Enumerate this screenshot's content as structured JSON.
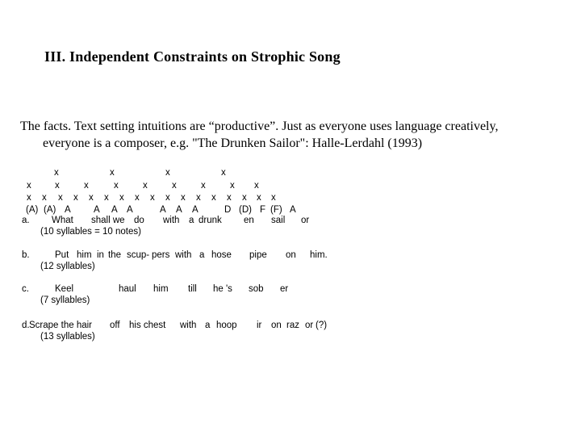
{
  "title": "III. Independent Constraints on Strophic Song",
  "paragraph": {
    "line1": "The facts. Text setting intuitions are “productive”. Just as everyone uses language creatively,",
    "line2": "everyone is a composer, e.g. \"The Drunken Sailor\": Halle-Lerdahl (1993)"
  },
  "grid": {
    "row1": [
      "x",
      "x",
      "x",
      "x"
    ],
    "row2": [
      "x",
      "x",
      "x",
      "x",
      "x",
      "x",
      "x",
      "x",
      "x"
    ],
    "row3": [
      "x",
      "x",
      "x",
      "x",
      "x",
      "x",
      "x",
      "x",
      "x",
      "x",
      "x",
      "x",
      "x",
      "x",
      "x",
      "x",
      "x"
    ],
    "pitches": [
      "(A)",
      "(A)",
      "A",
      "A",
      "A",
      "A",
      "A",
      "A",
      "A",
      "D",
      "(D)",
      "F",
      "(F)",
      "A"
    ]
  },
  "examples": {
    "a": {
      "label": "a.",
      "words": [
        "What",
        "shall we",
        "do",
        "with",
        "a",
        "drunk",
        "en",
        "sail",
        "or"
      ],
      "count": "(10 syllables = 10 notes)"
    },
    "b": {
      "label": "b.",
      "words": [
        "Put",
        "him",
        "in",
        "the",
        "scup-",
        "pers",
        "with",
        "a",
        "hose",
        "pipe",
        "on",
        "him."
      ],
      "count": "(12 syllables)"
    },
    "c": {
      "label": "c.",
      "words": [
        "Keel",
        "haul",
        "him",
        "till",
        "he 's",
        "sob",
        "er"
      ],
      "count": "(7 syllables)"
    },
    "d": {
      "label": "d.",
      "words": [
        "Scrape the hair",
        "off",
        "his chest",
        "with",
        "a",
        "hoop",
        "ir",
        "on",
        "raz",
        "or",
        "(?)"
      ],
      "count": "(13 syllables)"
    }
  }
}
